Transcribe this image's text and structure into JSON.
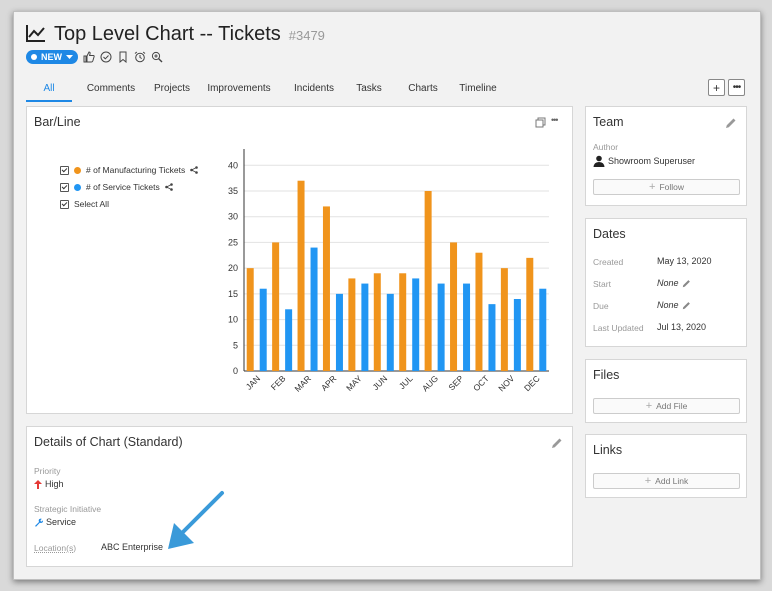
{
  "header": {
    "title": "Top Level Chart -- Tickets",
    "ticket_number": "#3479",
    "status_label": "NEW"
  },
  "tabs": [
    "All",
    "Comments",
    "Projects",
    "Improvements",
    "Incidents",
    "Tasks",
    "Charts",
    "Timeline"
  ],
  "chart_card": {
    "title": "Bar/Line",
    "legend": [
      {
        "label": "# of Manufacturing Tickets",
        "color": "#f0941c"
      },
      {
        "label": "# of Service Tickets",
        "color": "#2196f3"
      }
    ],
    "select_all": "Select All"
  },
  "chart_data": {
    "type": "bar",
    "categories": [
      "JAN",
      "FEB",
      "MAR",
      "APR",
      "MAY",
      "JUN",
      "JUL",
      "AUG",
      "SEP",
      "OCT",
      "NOV",
      "DEC"
    ],
    "series": [
      {
        "name": "# of Manufacturing Tickets",
        "color": "#f0941c",
        "values": [
          20,
          25,
          37,
          32,
          18,
          19,
          19,
          35,
          25,
          23,
          20,
          22
        ]
      },
      {
        "name": "# of Service Tickets",
        "color": "#2196f3",
        "values": [
          16,
          12,
          24,
          15,
          17,
          15,
          18,
          17,
          17,
          13,
          14,
          16
        ]
      }
    ],
    "y_ticks": [
      "0",
      "5",
      "10",
      "15",
      "20",
      "25",
      "30",
      "35",
      "40"
    ],
    "ylim": [
      0,
      42
    ],
    "grid": true,
    "legend_position": "top-left"
  },
  "details_card": {
    "title": "Details of Chart (Standard)",
    "priority_label": "Priority",
    "priority_value": "High",
    "initiative_label": "Strategic Initiative",
    "initiative_value": "Service",
    "location_label": "Location(s)",
    "location_value": "ABC Enterprise"
  },
  "team_card": {
    "title": "Team",
    "author_label": "Author",
    "author_name": "Showroom Superuser",
    "follow_label": "Follow"
  },
  "dates_card": {
    "title": "Dates",
    "created_label": "Created",
    "created_value": "May 13, 2020",
    "start_label": "Start",
    "start_value": "None",
    "due_label": "Due",
    "due_value": "None",
    "updated_label": "Last Updated",
    "updated_value": "Jul 13, 2020"
  },
  "files_card": {
    "title": "Files",
    "add_label": "Add File"
  },
  "links_card": {
    "title": "Links",
    "add_label": "Add Link"
  },
  "colors": {
    "accent": "#1e88e5",
    "priority_high": "#e53935",
    "annotation_arrow": "#3a9ad9"
  }
}
